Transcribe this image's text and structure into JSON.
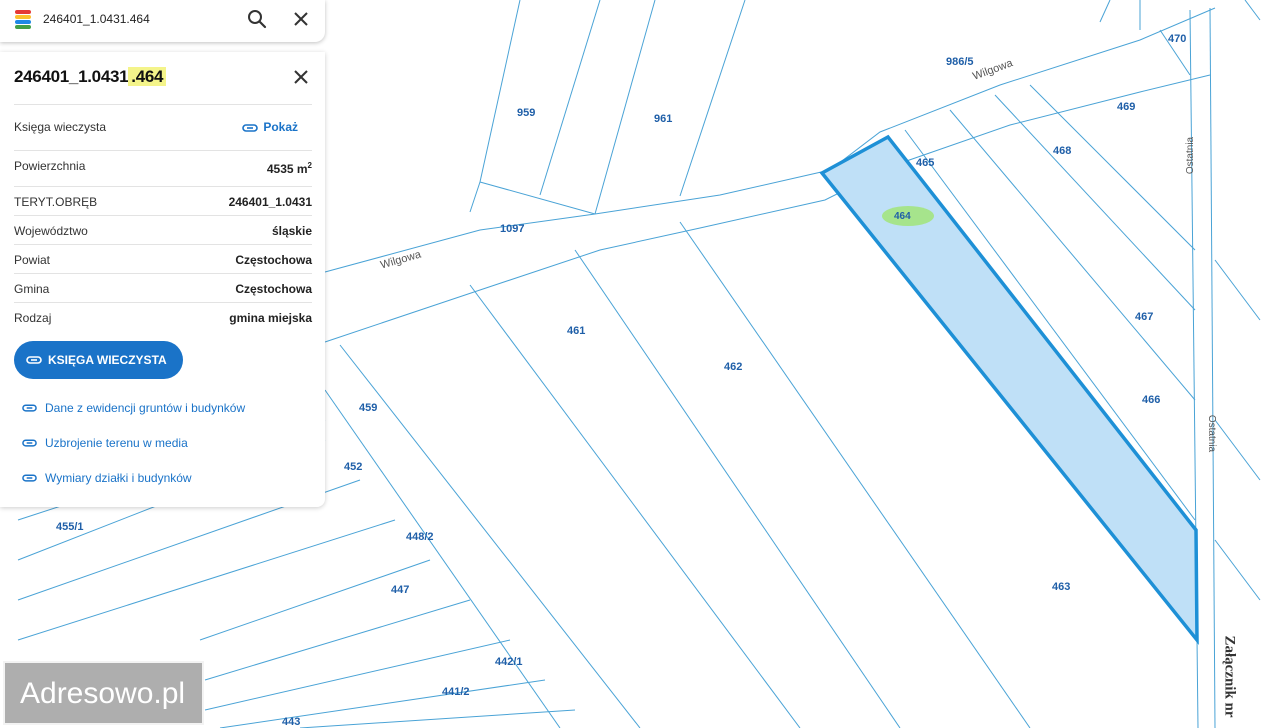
{
  "search": {
    "query": "246401_1.0431.464"
  },
  "panel": {
    "title_main": "246401_1.0431",
    "title_highlight": ".464",
    "rows": [
      {
        "key": "Księga wieczysta",
        "value": "Pokaż"
      },
      {
        "key": "Powierzchnia",
        "value": "4535 m",
        "sup": "2"
      },
      {
        "key": "TERYT.OBRĘB",
        "value": "246401_1.0431"
      },
      {
        "key": "Województwo",
        "value": "śląskie"
      },
      {
        "key": "Powiat",
        "value": "Częstochowa"
      },
      {
        "key": "Gmina",
        "value": "Częstochowa"
      },
      {
        "key": "Rodzaj",
        "value": "gmina miejska"
      }
    ],
    "primary_button": "KSIĘGA WIECZYSTA",
    "links": [
      "Dane z ewidencji gruntów i budynków",
      "Uzbrojenie terenu w media",
      "Wymiary działki i budynków"
    ]
  },
  "map": {
    "selected_plot": "464",
    "plots": [
      "959",
      "961",
      "986/5",
      "470",
      "469",
      "468",
      "465",
      "464",
      "1097",
      "461",
      "462",
      "467",
      "466",
      "463",
      "459",
      "452",
      "455/1",
      "448/2",
      "447",
      "442/1",
      "441/2",
      "443"
    ],
    "streets": [
      "Wilgowa",
      "Wilgowa",
      "Ostatnia",
      "Ostatnia",
      "Załącznik nr"
    ],
    "highlight_fill": "#bfe0f7",
    "highlight_stroke": "#1e90d6"
  },
  "watermark": "Adresowo.pl",
  "colors": {
    "accent": "#1a73c8",
    "label": "#1f5fa8"
  }
}
